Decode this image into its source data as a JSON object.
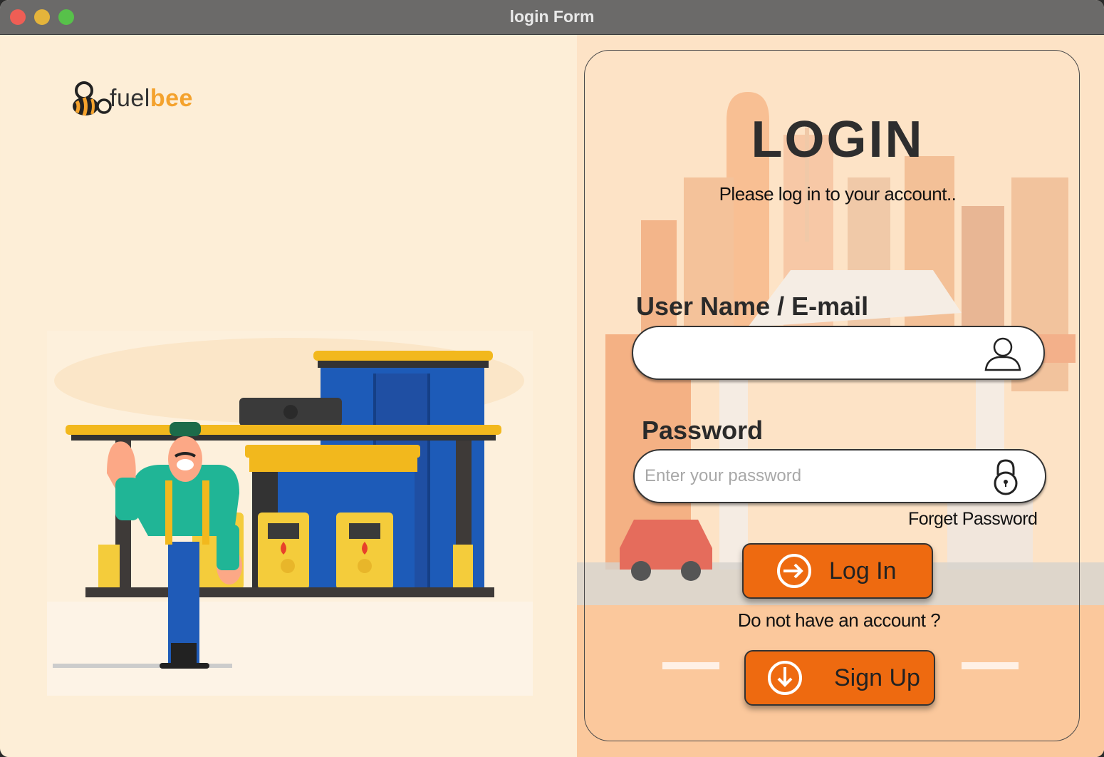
{
  "window": {
    "title": "login Form",
    "controls": [
      "close",
      "minimize",
      "maximize"
    ]
  },
  "brand": {
    "name_part1": "fuel",
    "name_part2": "bee",
    "logo_icon": "bee-icon",
    "accent_color": "#f4a22d"
  },
  "illustration": {
    "subject": "gas-station-attendant-illustration"
  },
  "login": {
    "heading": "LOGIN",
    "subtitle": "Please log in to your account..",
    "username_label": "User Name / E-mail",
    "username_value": "",
    "username_placeholder": "",
    "username_icon": "user-icon",
    "password_label": "Password",
    "password_value": "",
    "password_placeholder": "Enter your password",
    "password_icon": "lock-icon",
    "forget_password": "Forget Password",
    "login_button": "Log In",
    "login_icon": "sign-in-icon",
    "no_account_text": "Do not have an account ?",
    "signup_button": "Sign Up",
    "signup_icon": "download-circle-icon",
    "button_color": "#ee6a10"
  }
}
